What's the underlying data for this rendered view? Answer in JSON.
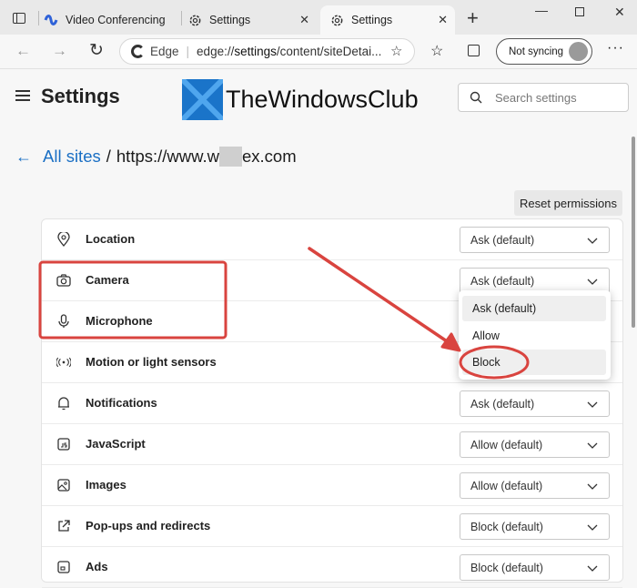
{
  "browser": {
    "tabs": [
      {
        "label": "Video Conferencing",
        "active": false
      },
      {
        "label": "Settings",
        "active": false
      },
      {
        "label": "Settings",
        "active": true
      }
    ],
    "new_tab": "+",
    "address": {
      "site_label": "Edge",
      "url_prefix": "edge://",
      "url_bold": "settings",
      "url_rest": "/content/siteDetai..."
    },
    "sync_label": "Not syncing"
  },
  "settings": {
    "title": "Settings",
    "search_placeholder": "Search settings",
    "watermark": "TheWindowsClub"
  },
  "breadcrumb": {
    "all_sites": "All sites",
    "separator": "/",
    "site_prefix": "https://www.w",
    "site_suffix": "ex.com"
  },
  "reset_button": "Reset permissions",
  "permissions": [
    {
      "label": "Location",
      "value": "Ask (default)",
      "icon": "location-icon"
    },
    {
      "label": "Camera",
      "value": "Ask (default)",
      "icon": "camera-icon"
    },
    {
      "label": "Microphone",
      "value": "",
      "icon": "microphone-icon"
    },
    {
      "label": "Motion or light sensors",
      "value": "",
      "icon": "sensor-icon"
    },
    {
      "label": "Notifications",
      "value": "Ask (default)",
      "icon": "bell-icon"
    },
    {
      "label": "JavaScript",
      "value": "Allow (default)",
      "icon": "javascript-icon"
    },
    {
      "label": "Images",
      "value": "Allow (default)",
      "icon": "image-icon"
    },
    {
      "label": "Pop-ups and redirects",
      "value": "Block (default)",
      "icon": "popup-icon"
    },
    {
      "label": "Ads",
      "value": "Block (default)",
      "icon": "ads-icon"
    }
  ],
  "dropdown_options": [
    "Ask (default)",
    "Allow",
    "Block"
  ],
  "annotation_color": "#d9443f"
}
